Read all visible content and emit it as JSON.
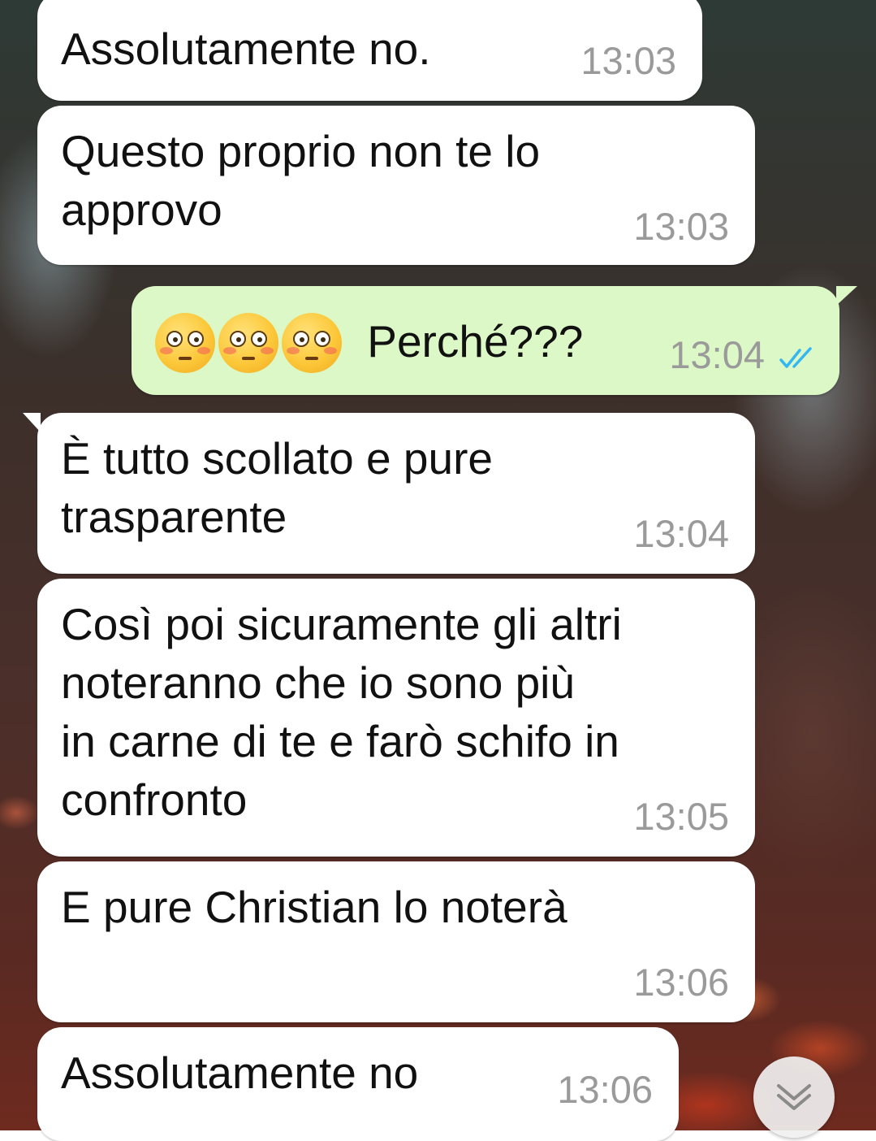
{
  "chat": {
    "messages": [
      {
        "direction": "incoming",
        "text": "Assolutamente no.",
        "time": "13:03"
      },
      {
        "direction": "incoming",
        "text": "Questo proprio non te lo\napprovo",
        "time": "13:03"
      },
      {
        "direction": "outgoing",
        "emoji": "flushed-face",
        "emoji_count": 3,
        "text": "Perché???",
        "time": "13:04",
        "status": "read"
      },
      {
        "direction": "incoming",
        "text": "È tutto scollato e pure\ntrasparente",
        "time": "13:04"
      },
      {
        "direction": "incoming",
        "text": "Così poi sicuramente gli altri\nnoteranno che io sono più\nin carne di te e farò schifo in\nconfronto",
        "time": "13:05"
      },
      {
        "direction": "incoming",
        "text": "E pure Christian lo noterà",
        "time": "13:06"
      },
      {
        "direction": "incoming",
        "text": "Assolutamente no",
        "time": "13:06"
      }
    ]
  },
  "colors": {
    "incoming_bubble": "#ffffff",
    "outgoing_bubble": "#dcf8c6",
    "time_text": "#9a9a9a",
    "read_ticks": "#34b7f1"
  },
  "icons": {
    "read_receipt": "double-check-icon",
    "scroll_down": "chevron-double-down-icon"
  }
}
